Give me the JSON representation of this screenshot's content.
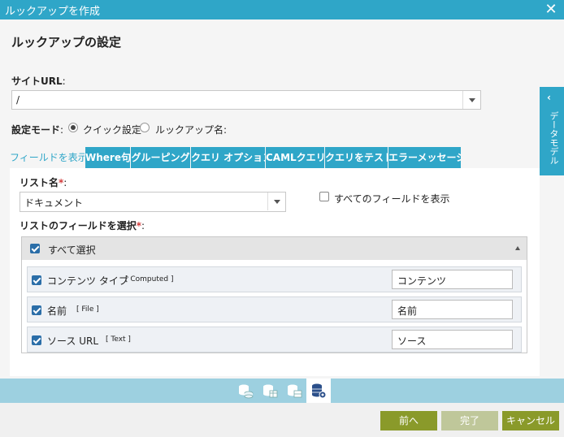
{
  "dialog": {
    "title": "ルックアップを作成"
  },
  "section_title": "ルックアップの設定",
  "site_url": {
    "label": "サイトURL",
    "colon": ":",
    "value": "/"
  },
  "mode": {
    "label": "設定モード",
    "colon": ":",
    "options": [
      "クイック設定",
      "ルックアップ名"
    ],
    "selected": "クイック設定",
    "trailing": ":"
  },
  "tabs": [
    "フィールドを表示",
    "Where句",
    "グルーピング",
    "クエリ オプション",
    "CAMLクエリ",
    "クエリをテスト",
    "エラーメッセージ"
  ],
  "active_tab": "フィールドを表示",
  "list_name": {
    "label": "リスト名",
    "required": "*",
    "colon": ":",
    "value": "ドキュメント"
  },
  "show_all_fields": {
    "label": "すべてのフィールドを表示",
    "checked": false
  },
  "fields_select": {
    "label": "リストのフィールドを選択",
    "required": "*",
    "colon": ":"
  },
  "select_all": {
    "label": "すべて選択",
    "checked": true
  },
  "fields": [
    {
      "name": "コンテンツ タイプ",
      "type": "[ Computed ]",
      "display": "コンテンツ",
      "checked": true
    },
    {
      "name": "名前",
      "type": "[ File ]",
      "display": "名前",
      "checked": true
    },
    {
      "name": "ソース URL",
      "type": "[ Text ]",
      "display": "ソース",
      "checked": true
    }
  ],
  "side_panel": {
    "label": "データモデル"
  },
  "footer": {
    "prev": "前へ",
    "finish": "完了",
    "cancel": "キャンセル"
  },
  "colors": {
    "accent": "#2fa6c8",
    "primary_button": "#8a9a2a",
    "disabled_button": "#bfc79a",
    "required": "#d23c3c"
  }
}
